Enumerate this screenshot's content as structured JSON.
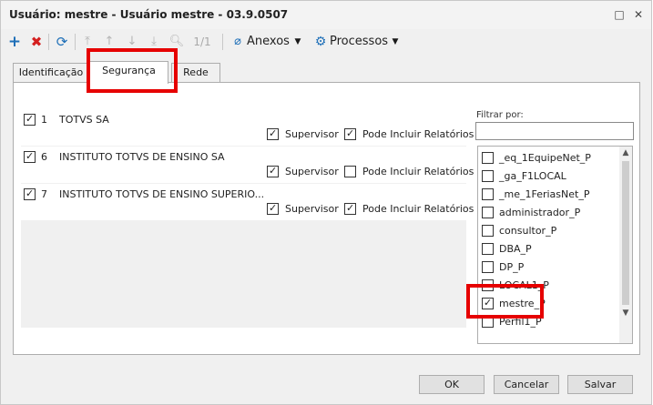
{
  "window": {
    "title": "Usuário: mestre - Usuário mestre - 03.9.0507"
  },
  "toolbar": {
    "counter": "1/1",
    "attachments_label": "Anexos",
    "processes_label": "Processos"
  },
  "tabs": [
    {
      "label": "Identificação"
    },
    {
      "label": "Segurança"
    },
    {
      "label": "Rede"
    }
  ],
  "groups": [
    {
      "code": "1",
      "name": "TOTVS SA",
      "checked": true,
      "supervisor_label": "Supervisor",
      "supervisor": true,
      "reports_label": "Pode Incluir Relatórios",
      "reports": true
    },
    {
      "code": "6",
      "name": "INSTITUTO TOTVS DE ENSINO SA",
      "checked": true,
      "supervisor_label": "Supervisor",
      "supervisor": true,
      "reports_label": "Pode Incluir Relatórios",
      "reports": false
    },
    {
      "code": "7",
      "name": "INSTITUTO TOTVS DE ENSINO SUPERIO...",
      "checked": true,
      "supervisor_label": "Supervisor",
      "supervisor": true,
      "reports_label": "Pode Incluir Relatórios",
      "reports": true
    }
  ],
  "filter": {
    "label": "Filtrar por:",
    "value": ""
  },
  "roles": [
    {
      "label": "_eq_1EquipeNet_P",
      "checked": false
    },
    {
      "label": "_ga_F1LOCAL",
      "checked": false
    },
    {
      "label": "_me_1FeriasNet_P",
      "checked": false
    },
    {
      "label": "administrador_P",
      "checked": false
    },
    {
      "label": "consultor_P",
      "checked": false
    },
    {
      "label": "DBA_P",
      "checked": false
    },
    {
      "label": "DP_P",
      "checked": false
    },
    {
      "label": "LOCAL1_P",
      "checked": false
    },
    {
      "label": "mestre_P",
      "checked": true
    },
    {
      "label": "Perfil1_P",
      "checked": false
    }
  ],
  "footer": {
    "ok_label": "OK",
    "cancel_label": "Cancelar",
    "save_label": "Salvar"
  },
  "icons": {
    "add": "plus-icon",
    "delete": "x-icon",
    "refresh": "refresh-icon",
    "first": "first-icon",
    "prev": "up-icon",
    "next": "down-icon",
    "last": "last-icon",
    "search": "search-icon",
    "attach": "paperclip-icon",
    "processes": "gear-icon"
  },
  "colors": {
    "accent": "#1e6fb8",
    "delete": "#d42020",
    "highlight": "#e60000"
  }
}
